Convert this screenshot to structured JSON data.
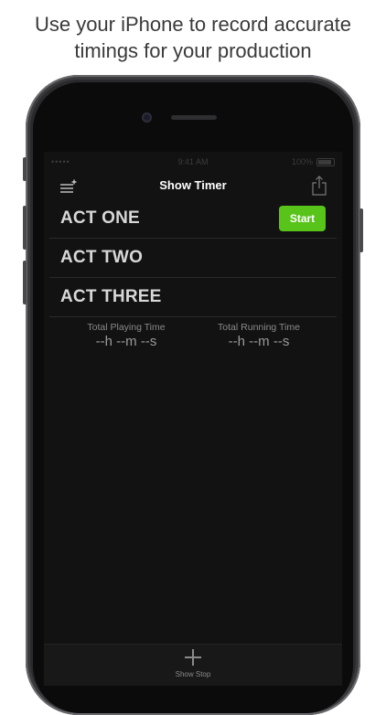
{
  "caption": {
    "line1": "Use your iPhone to record accurate",
    "line2": "timings for your production"
  },
  "status_bar": {
    "carrier": "•••••",
    "time": "9:41 AM",
    "battery": "100%"
  },
  "nav": {
    "title": "Show Timer",
    "menu_icon": "list-add-icon",
    "share_icon": "share-icon"
  },
  "acts": [
    {
      "label": "ACT ONE",
      "button": "Start"
    },
    {
      "label": "ACT TWO"
    },
    {
      "label": "ACT THREE"
    }
  ],
  "totals": {
    "playing": {
      "label": "Total Playing Time",
      "value": "--h --m --s"
    },
    "running": {
      "label": "Total Running Time",
      "value": "--h --m --s"
    }
  },
  "toolbar": {
    "icon": "plus-icon",
    "label": "Show Stop"
  },
  "colors": {
    "accent_green": "#58c41a",
    "screen_bg": "#121212",
    "text_primary": "#ffffff"
  }
}
